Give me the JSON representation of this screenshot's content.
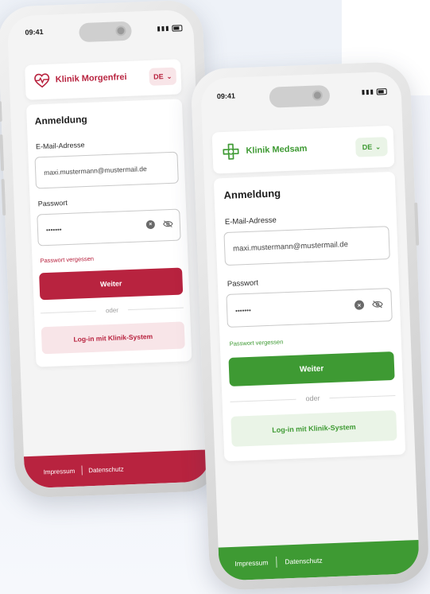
{
  "colors": {
    "morgenfrei_accent": "#b8233f",
    "morgenfrei_soft": "#f8e5e8",
    "medsam_accent": "#3e9a33",
    "medsam_soft": "#eaf4e7"
  },
  "phones": [
    {
      "status_time": "09:41",
      "status_icons": "signal-wifi-battery",
      "brand_icon": "heart-pulse-icon",
      "brand_name": "Klinik Morgenfrei",
      "lang": "DE",
      "heading": "Anmeldung",
      "email_label": "E-Mail-Adresse",
      "email_value": "maxi.mustermann@mustermail.de",
      "password_label": "Passwort",
      "password_value": "•••••••",
      "forgot_link": "Passwort vergessen",
      "primary_button": "Weiter",
      "divider_text": "oder",
      "secondary_button": "Log-in mit Klinik-System",
      "footer_links": [
        "Impressum",
        "Datenschutz"
      ]
    },
    {
      "status_time": "09:41",
      "status_icons": "signal-wifi-battery",
      "brand_icon": "medical-cross-icon",
      "brand_name": "Klinik Medsam",
      "lang": "DE",
      "heading": "Anmeldung",
      "email_label": "E-Mail-Adresse",
      "email_value": "maxi.mustermann@mustermail.de",
      "password_label": "Passwort",
      "password_value": "•••••••",
      "forgot_link": "Passwort vergessen",
      "primary_button": "Weiter",
      "divider_text": "oder",
      "secondary_button": "Log-in mit Klinik-System",
      "footer_links": [
        "Impressum",
        "Datenschutz"
      ]
    }
  ]
}
